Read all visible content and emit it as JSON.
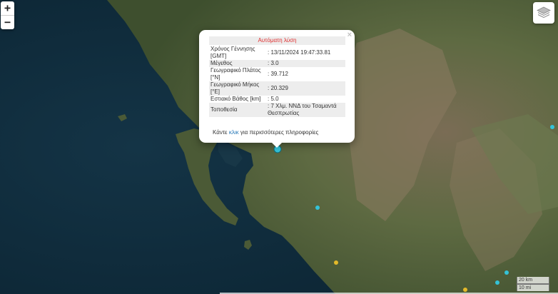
{
  "map": {
    "controls": {
      "zoom_in_label": "+",
      "zoom_out_label": "−",
      "layers_icon": "layers-icon"
    },
    "popup": {
      "title": "Αυτόματη λύση",
      "rows": [
        {
          "label": "Χρόνος Γέννησης [GMT]",
          "value": ": 13/11/2024 19:47:33.81"
        },
        {
          "label": "Μέγεθος",
          "value": ": 3.0"
        },
        {
          "label": "Γεωγραφικό Πλάτος [°N]",
          "value": ": 39.712"
        },
        {
          "label": "Γεωγραφικό Μήκος [°E]",
          "value": ": 20.329"
        },
        {
          "label": "Εστιακό Βάθος [km]",
          "value": ": 5.0"
        },
        {
          "label": "Τοποθεσία",
          "value": ": 7 Χλμ. ΝΝΔ του Τσαμαντά Θεσπρωτίας"
        }
      ],
      "footer_prefix": "Κάντε",
      "footer_link": "κλικ",
      "footer_suffix": "για περισσότερες πληροφορίες",
      "close_label": "×"
    },
    "scale": {
      "km_label": "20 km",
      "mi_label": "10 mi"
    },
    "colors": {
      "sea": "#0f2a3a",
      "land": "#5b6a3f",
      "mountain": "#7d6f55",
      "popup_title": "#e03030",
      "link": "#2a7ab8",
      "event_marker": "#34c3d8",
      "event_marker_yellow": "#e3b92a"
    }
  }
}
